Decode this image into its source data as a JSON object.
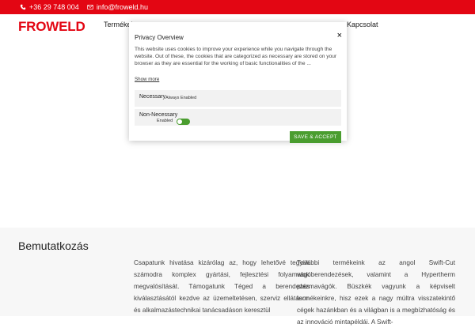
{
  "topbar": {
    "phone": "+36 29 748 004",
    "email": "info@froweld.hu"
  },
  "nav": {
    "logo": "FROWELD",
    "items": [
      "Termékek",
      "Kapcsolat"
    ]
  },
  "about": {
    "title": "Bemutatkozás",
    "col1": "Csapatunk hivatása kizárólag az, hogy lehetővé tegyük számodra komplex gyártási, fejlesztési folyamatok megvalósítását. Támogatunk Téged a berendezés kiválasztásától kezdve az üzemeltetésen, szerviz ellátáson és alkalmazástechnikai tanácsadáson keresztül",
    "col2": "További termékeink az angol Swift-Cut vágóberendezések, valamint a Hypertherm plazmavágók. Büszkék vagyunk a képviselt termékeinkre, hisz ezek a nagy múltra visszatekintő cégek hazánkban és a világban is a megbízhatóság és az innováció mintapéldái. A Swift-"
  },
  "privacy_modal": {
    "title": "Privacy Overview",
    "close": "×",
    "description": "This website uses cookies to improve your experience while you navigate through the website. Out of these, the cookies that are categorized as necessary are stored on your browser as they are essential for the working of basic functionalities of the ...",
    "show_more": "Show more",
    "necessary": {
      "label": "Necessary",
      "tag": "Always Enabled"
    },
    "non_necessary": {
      "label": "Non-Necessary",
      "tag": "Enabled",
      "enabled": true
    },
    "save_button": "SAVE & ACCEPT"
  },
  "colors": {
    "brand": "#e30613",
    "accept": "#4a9d2f"
  }
}
